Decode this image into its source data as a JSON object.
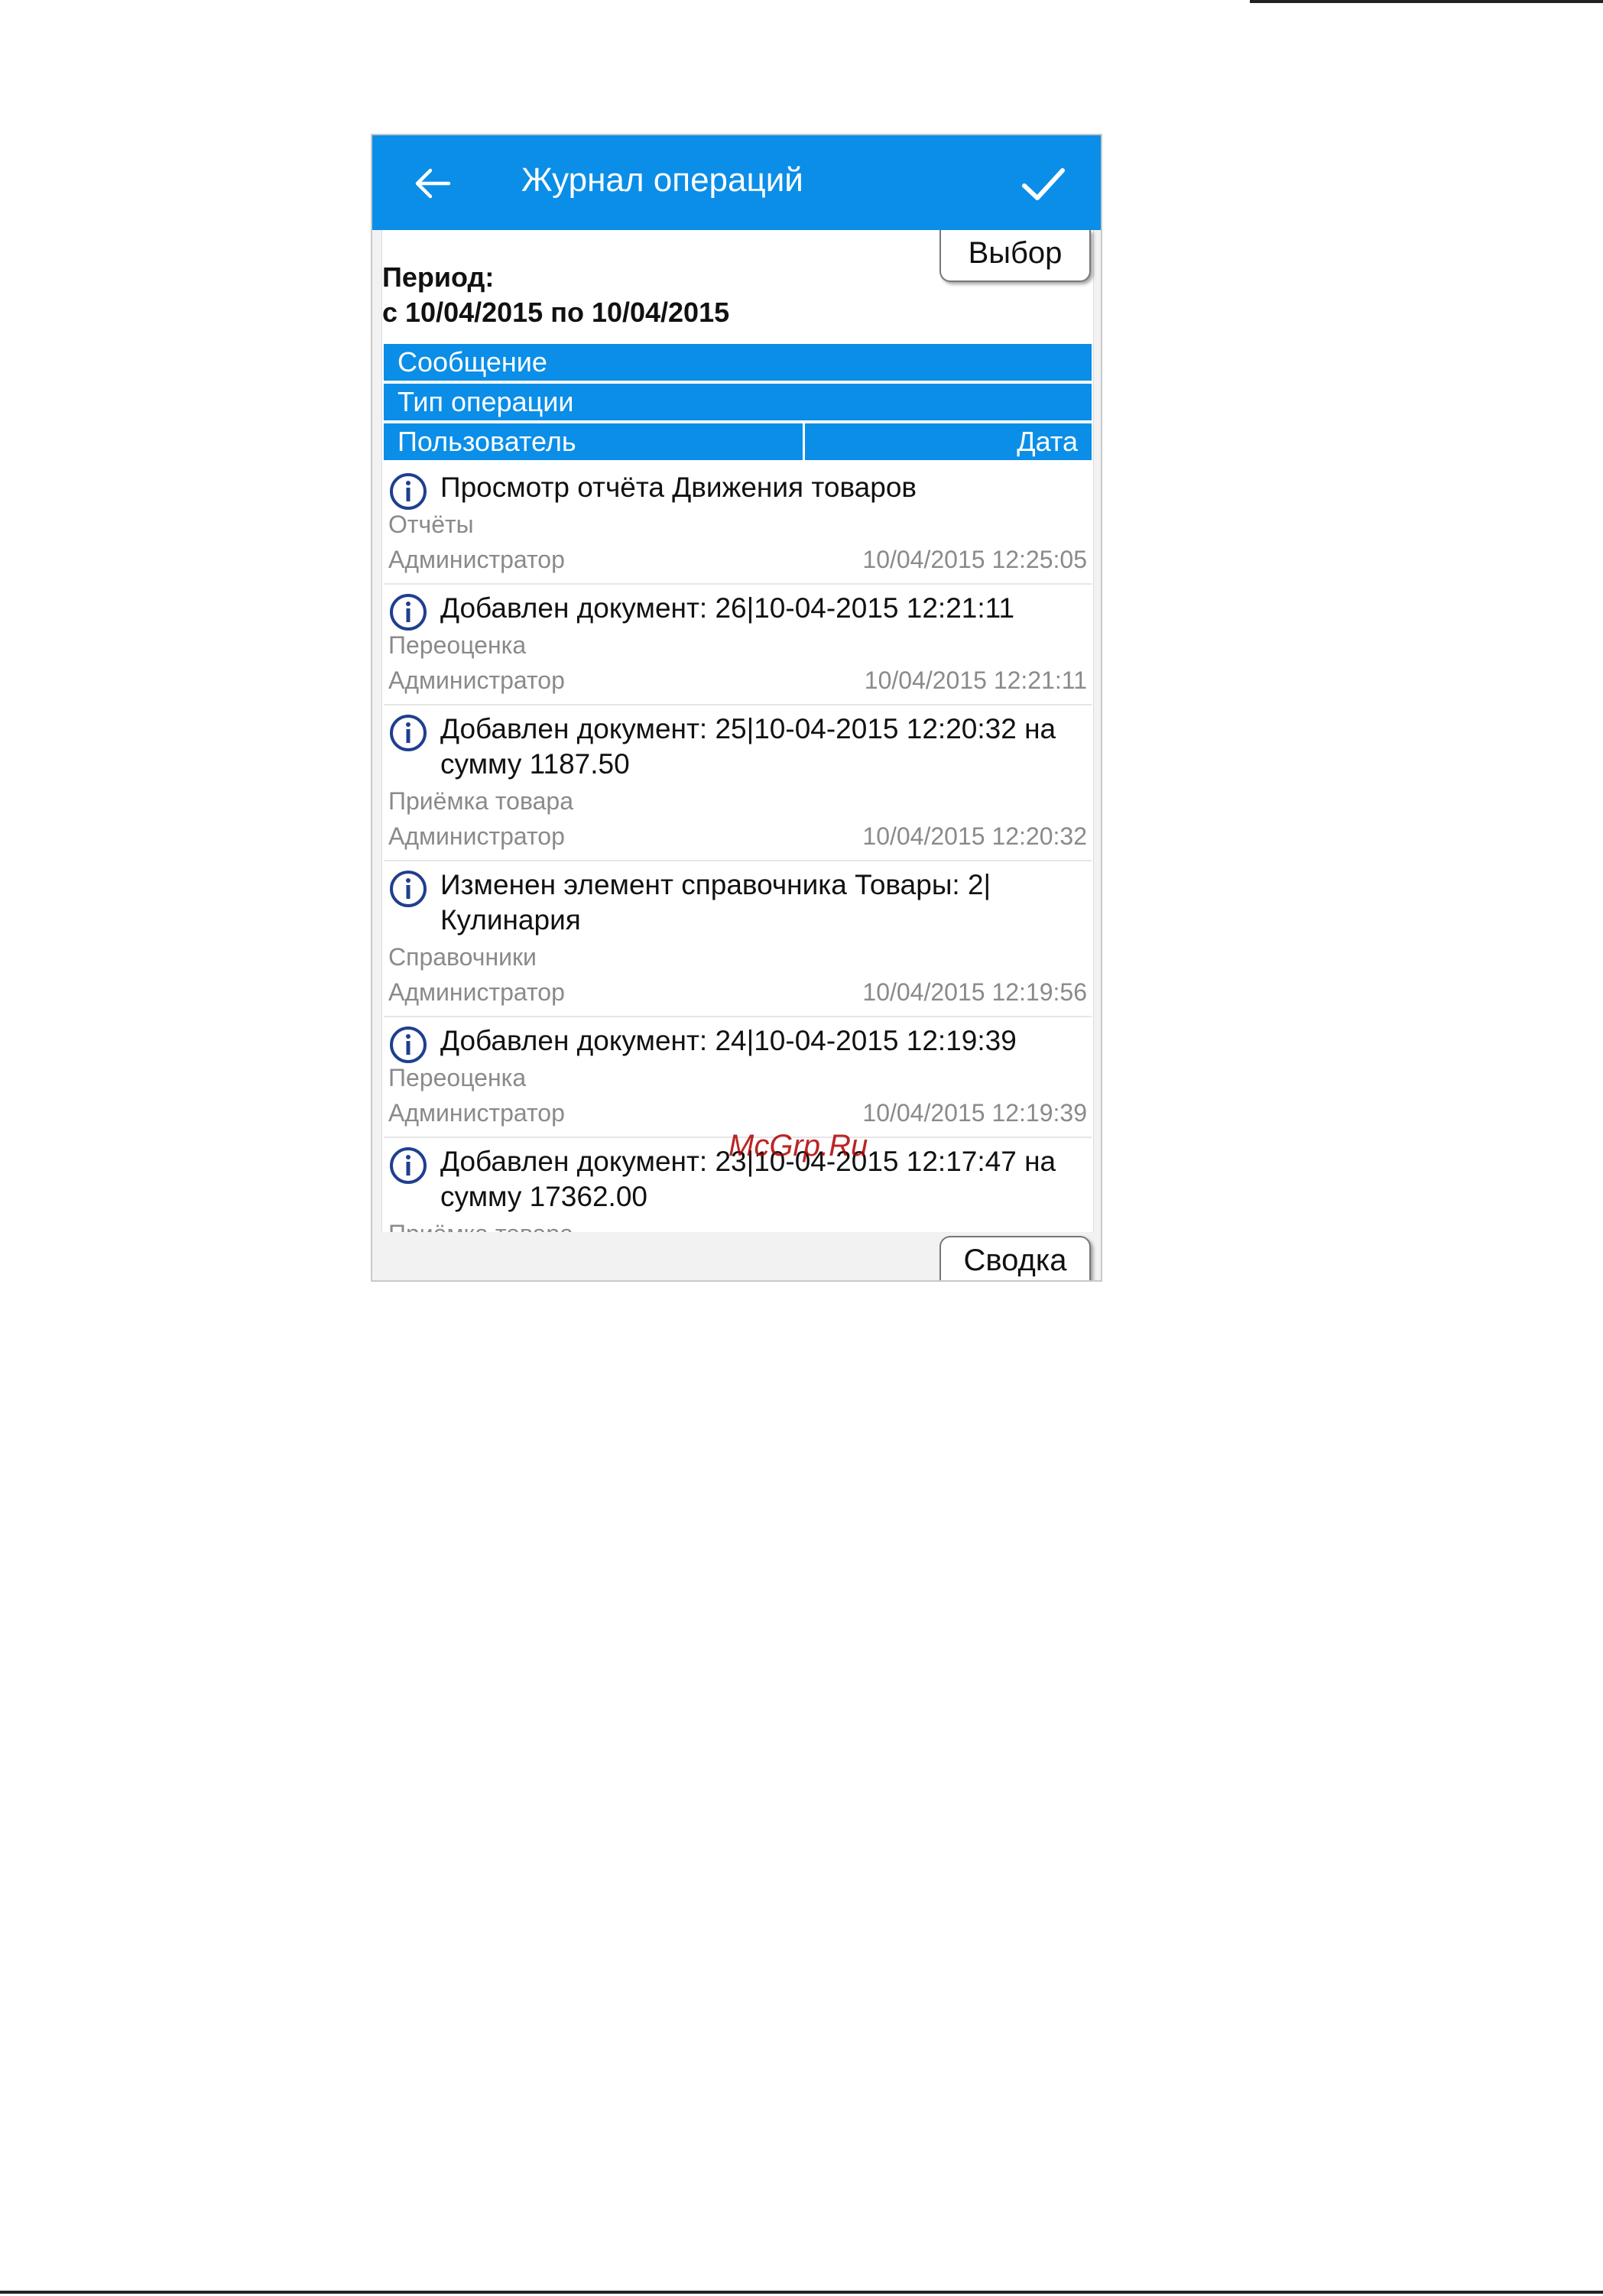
{
  "appbar": {
    "title": "Журнал операций",
    "back_icon": "arrow-left-icon",
    "confirm_icon": "check-icon"
  },
  "buttons": {
    "select": "Выбор",
    "summary": "Сводка"
  },
  "period": {
    "label": "Период:",
    "range": "с 10/04/2015 по 10/04/2015"
  },
  "columns": {
    "message": "Сообщение",
    "op_type": "Тип операции",
    "user": "Пользователь",
    "date": "Дата"
  },
  "entries": [
    {
      "message": "Просмотр отчёта Движения товаров",
      "type": "Отчёты",
      "user": "Администратор",
      "date": "10/04/2015 12:25:05"
    },
    {
      "message": "Добавлен документ: 26|10-04-2015 12:21:11",
      "type": "Переоценка",
      "user": "Администратор",
      "date": "10/04/2015 12:21:11"
    },
    {
      "message": "Добавлен документ: 25|10-04-2015 12:20:32 на сумму 1187.50",
      "type": "Приёмка товара",
      "user": "Администратор",
      "date": "10/04/2015 12:20:32"
    },
    {
      "message": "Изменен элемент справочника Товары: 2|Кулинария",
      "type": "Справочники",
      "user": "Администратор",
      "date": "10/04/2015 12:19:56"
    },
    {
      "message": "Добавлен документ: 24|10-04-2015 12:19:39",
      "type": "Переоценка",
      "user": "Администратор",
      "date": "10/04/2015 12:19:39"
    },
    {
      "message": "Добавлен документ: 23|10-04-2015 12:17:47 на сумму 17362.00",
      "type": "Приёмка товара",
      "user": "",
      "date": ""
    }
  ],
  "watermark": "McGrp.Ru",
  "colors": {
    "accent": "#0a8ee8",
    "info_icon": "#1f3f8f"
  }
}
